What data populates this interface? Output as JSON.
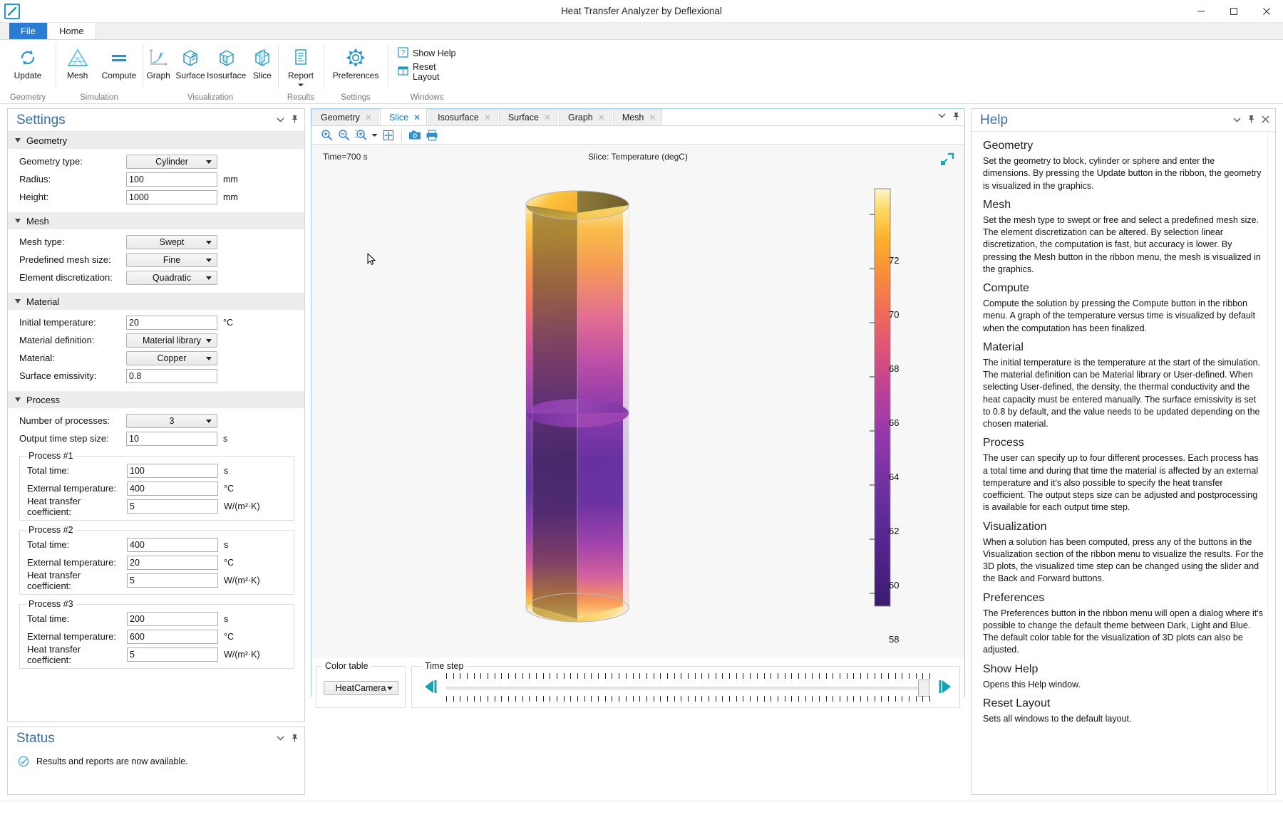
{
  "window": {
    "title": "Heat Transfer Analyzer by Deflexional",
    "logo_icon": "app-logo-icon",
    "minimize": "─",
    "maximize": "☐",
    "close": "✕"
  },
  "ribbon": {
    "tabs": [
      {
        "label": "File",
        "id": "file"
      },
      {
        "label": "Home",
        "id": "home"
      }
    ],
    "groups": [
      {
        "title": "Geometry",
        "buttons": [
          {
            "label": "Update",
            "icon": "refresh-icon"
          }
        ]
      },
      {
        "title": "Simulation",
        "buttons": [
          {
            "label": "Mesh",
            "icon": "mesh-triangle-icon"
          },
          {
            "label": "Compute",
            "icon": "equals-icon"
          }
        ]
      },
      {
        "title": "Visualization",
        "buttons": [
          {
            "label": "Graph",
            "icon": "graph-curve-icon"
          },
          {
            "label": "Surface",
            "icon": "surface-cube-icon"
          },
          {
            "label": "Isosurface",
            "icon": "isosurface-cube-icon"
          },
          {
            "label": "Slice",
            "icon": "slice-cube-icon"
          }
        ]
      },
      {
        "title": "Results",
        "buttons": [
          {
            "label": "Report",
            "icon": "report-document-icon",
            "has_dropdown": true
          }
        ]
      },
      {
        "title": "Settings",
        "buttons": [
          {
            "label": "Preferences",
            "icon": "gear-icon"
          }
        ]
      },
      {
        "title": "Windows",
        "small_buttons": [
          {
            "label": "Show Help",
            "icon": "question-box-icon"
          },
          {
            "label": "Reset Layout",
            "icon": "layout-grid-icon"
          }
        ]
      }
    ]
  },
  "settings": {
    "title": "Settings",
    "collapse_icon": "chevron-down-icon",
    "pin_icon": "pin-icon",
    "sections": {
      "geometry": {
        "header": "Geometry",
        "fields": [
          {
            "label": "Geometry type:",
            "type": "combo",
            "value": "Cylinder",
            "unit": ""
          },
          {
            "label": "Radius:",
            "type": "text",
            "value": "100",
            "unit": "mm"
          },
          {
            "label": "Height:",
            "type": "text",
            "value": "1000",
            "unit": "mm"
          }
        ]
      },
      "mesh": {
        "header": "Mesh",
        "fields": [
          {
            "label": "Mesh type:",
            "type": "combo",
            "value": "Swept",
            "unit": ""
          },
          {
            "label": "Predefined mesh size:",
            "type": "combo",
            "value": "Fine",
            "unit": ""
          },
          {
            "label": "Element discretization:",
            "type": "combo",
            "value": "Quadratic",
            "unit": ""
          }
        ]
      },
      "material": {
        "header": "Material",
        "fields": [
          {
            "label": "Initial temperature:",
            "type": "text",
            "value": "20",
            "unit": "°C"
          },
          {
            "label": "Material definition:",
            "type": "combo",
            "value": "Material library",
            "unit": ""
          },
          {
            "label": "Material:",
            "type": "combo",
            "value": "Copper",
            "unit": ""
          },
          {
            "label": "Surface emissivity:",
            "type": "text",
            "value": "0.8",
            "unit": ""
          }
        ]
      },
      "process": {
        "header": "Process",
        "fields": [
          {
            "label": "Number of processes:",
            "type": "combo",
            "value": "3",
            "unit": ""
          },
          {
            "label": "Output time step size:",
            "type": "text",
            "value": "10",
            "unit": "s"
          }
        ],
        "groups": [
          {
            "legend": "Process #1",
            "fields": [
              {
                "label": "Total time:",
                "value": "100",
                "unit": "s"
              },
              {
                "label": "External temperature:",
                "value": "400",
                "unit": "°C"
              },
              {
                "label": "Heat transfer coefficient:",
                "value": "5",
                "unit": "W/(m²·K)"
              }
            ]
          },
          {
            "legend": "Process #2",
            "fields": [
              {
                "label": "Total time:",
                "value": "400",
                "unit": "s"
              },
              {
                "label": "External temperature:",
                "value": "20",
                "unit": "°C"
              },
              {
                "label": "Heat transfer coefficient:",
                "value": "5",
                "unit": "W/(m²·K)"
              }
            ]
          },
          {
            "legend": "Process #3",
            "fields": [
              {
                "label": "Total time:",
                "value": "200",
                "unit": "s"
              },
              {
                "label": "External temperature:",
                "value": "600",
                "unit": "°C"
              },
              {
                "label": "Heat transfer coefficient:",
                "value": "5",
                "unit": "W/(m²·K)"
              }
            ]
          }
        ]
      }
    }
  },
  "status": {
    "title": "Status",
    "message": "Results and reports are now available.",
    "icon": "check-circle-icon",
    "collapse_icon": "chevron-down-icon",
    "pin_icon": "pin-icon"
  },
  "graphics": {
    "tabs": [
      {
        "label": "Geometry",
        "active": false
      },
      {
        "label": "Slice",
        "active": true
      },
      {
        "label": "Isosurface",
        "active": false
      },
      {
        "label": "Surface",
        "active": false
      },
      {
        "label": "Graph",
        "active": false
      },
      {
        "label": "Mesh",
        "active": false
      }
    ],
    "tab_close_glyph": "✕",
    "toolbar": [
      {
        "icon": "zoom-in-icon"
      },
      {
        "icon": "zoom-out-icon"
      },
      {
        "icon": "zoom-box-icon",
        "has_dropdown": true
      },
      {
        "icon": "zoom-extents-icon"
      },
      {
        "icon": "camera-icon"
      },
      {
        "icon": "print-icon"
      }
    ],
    "time_label": "Time=700 s",
    "plot_title": "Slice: Temperature (degC)",
    "expand_icon": "expand-arrow-icon",
    "color_table": {
      "legend": "Color table",
      "value": "HeatCamera"
    },
    "time_step": {
      "legend": "Time step",
      "back_icon": "step-back-icon",
      "forward_icon": "step-forward-icon",
      "position_percent": 100,
      "tick_count": 71
    }
  },
  "chart_data": {
    "type": "heatmap",
    "title": "Slice: Temperature (degC)",
    "annotation": "Time=700 s",
    "colormap": "HeatCamera",
    "colorbar": {
      "ticks": [
        58,
        60,
        62,
        64,
        66,
        68,
        70,
        72
      ],
      "min": 57.2,
      "max": 73.4,
      "unit": "degC",
      "label": "Temperature (degC)"
    },
    "geometry": {
      "shape": "Cylinder",
      "radius_mm": 100,
      "height_mm": 1000
    },
    "slices": [
      "vertical-xz",
      "vertical-yz",
      "horizontal-mid"
    ],
    "description": "Temperature field on orthogonal slice planes through a copper cylinder; hot (yellow ~73) at top and bottom ends, cool (purple ~58) in the middle."
  },
  "help": {
    "title": "Help",
    "collapse_icon": "chevron-down-icon",
    "pin_icon": "pin-icon",
    "close_icon": "close-icon",
    "sections": [
      {
        "heading": "Geometry",
        "body": "Set the geometry to block, cylinder or sphere and enter the dimensions. By pressing the Update button in the ribbon, the geometry is visualized in the graphics."
      },
      {
        "heading": "Mesh",
        "body": "Set the mesh type to swept or free and select a predefined mesh size.  The element discretization can be altered. By selection linear discretization, the computation is fast, but accuracy is lower.  By pressing the Mesh button in the ribbon menu, the mesh is visualized in the graphics."
      },
      {
        "heading": "Compute",
        "body": "Compute the solution by pressing the Compute button in the ribbon menu. A graph of the temperature versus time is visualized by default when the computation has been finalized."
      },
      {
        "heading": "Material",
        "body": "The initial temperature is the temperature at the start of the simulation. The material definition can be Material library or User-defined. When selecting User-defined, the density, the thermal conductivity and the heat capacity must be entered manually. The surface emissivity is set to 0.8 by default, and the value needs to be updated depending on the chosen material."
      },
      {
        "heading": "Process",
        "body": "The user can specify up to four different processes. Each process has a total time and during that time the material is affected by an external temperature and it's also possible to specify the heat transfer coefficient. The output steps size can be adjusted and postprocessing is available for each output time step."
      },
      {
        "heading": "Visualization",
        "body": "When a solution has been computed, press any of the buttons in the Visualization section of the ribbon menu to visualize the results. For the 3D plots, the visualized time step can be changed using the slider and the Back and Forward buttons."
      },
      {
        "heading": "Preferences",
        "body": "The Preferences button in the ribbon menu will open a dialog where it's possible to change the default theme between Dark, Light and Blue. The default color table for the visualization of 3D plots can also be adjusted."
      },
      {
        "heading": "Show Help",
        "body": "Opens this Help window."
      },
      {
        "heading": "Reset Layout",
        "body": "Sets all windows to the default layout."
      }
    ]
  },
  "colors": {
    "accent": "#2196c4",
    "file_tab": "#2b7cd3",
    "panel_title": "#3a6ea5",
    "active_tab_text": "#1879c9",
    "teal": "#1a9ab0"
  }
}
